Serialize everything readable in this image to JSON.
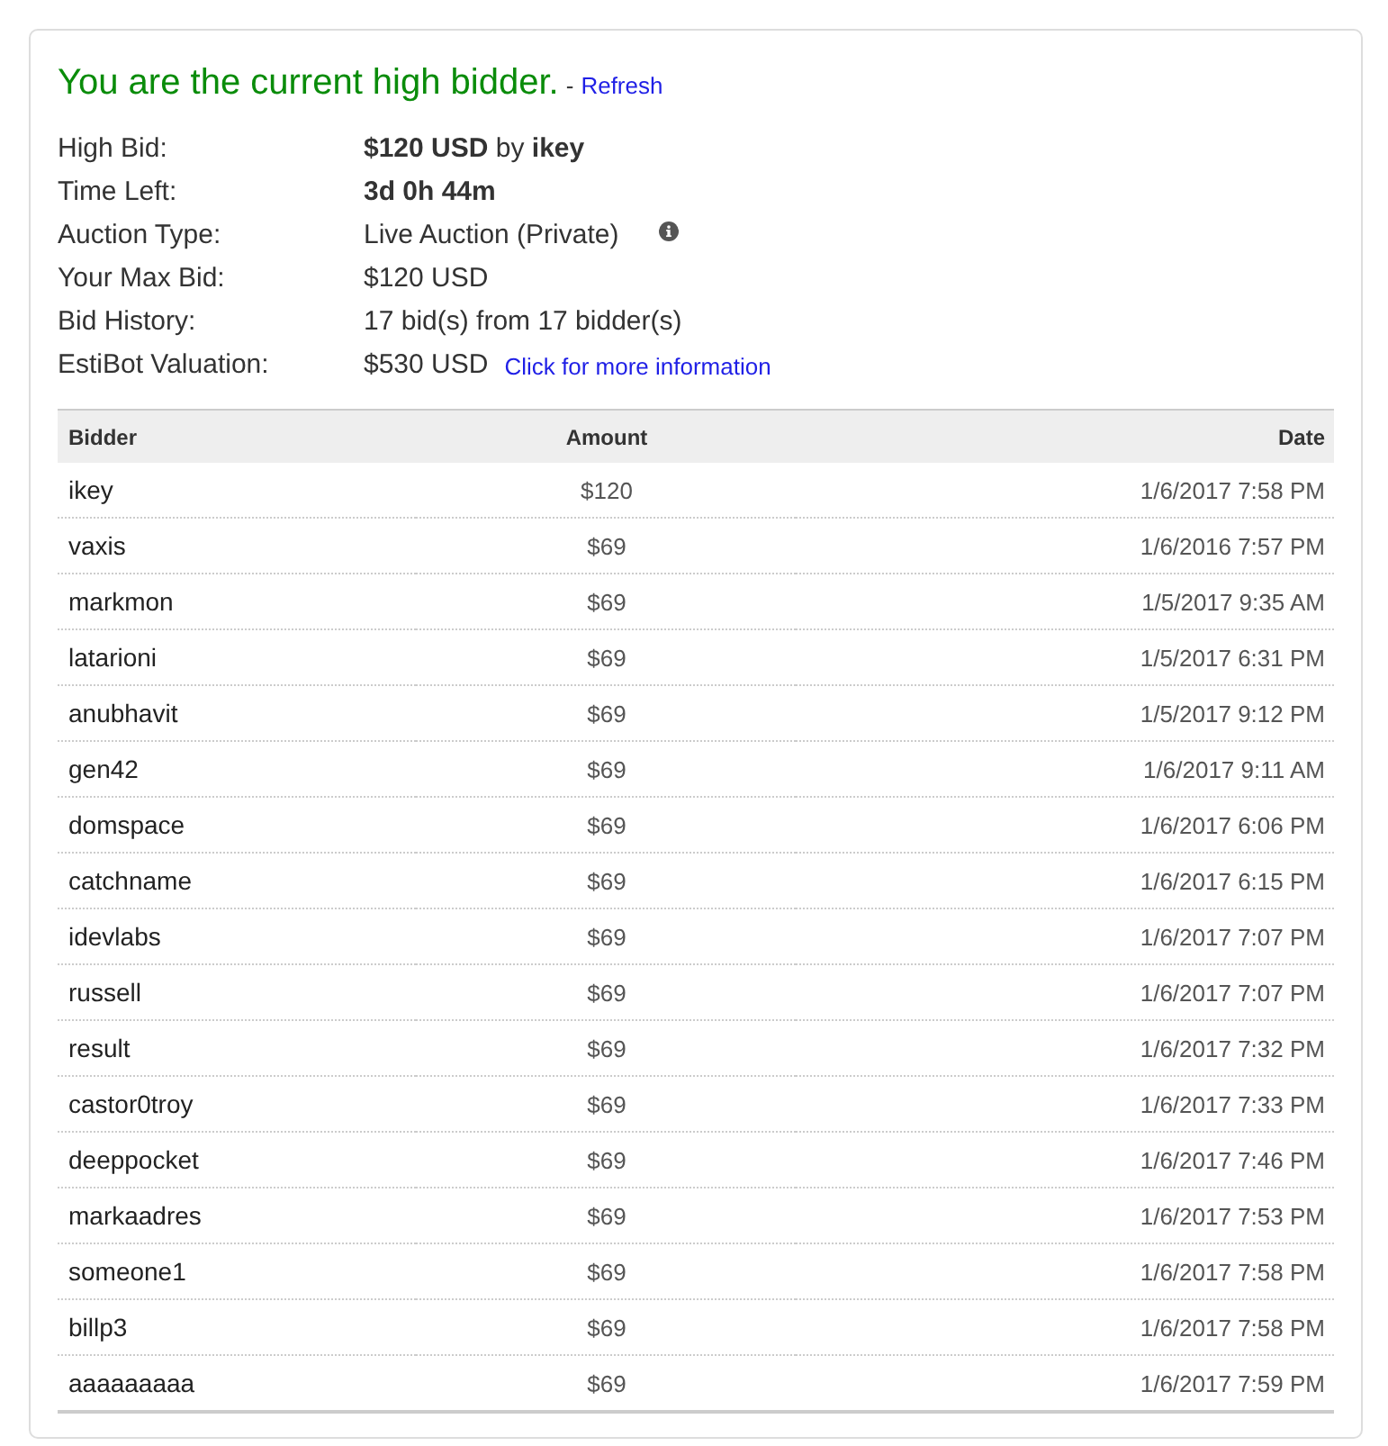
{
  "status": {
    "message": "You are the current high bidder.",
    "separator": "-",
    "refresh_link": "Refresh"
  },
  "details": [
    {
      "label": "High Bid:",
      "value": "**$120 USD** by **ikey**",
      "bold": false,
      "info_icon": false
    },
    {
      "label": "Time Left:",
      "value": "3d 0h 44m",
      "bold": true,
      "info_icon": false
    },
    {
      "label": "Auction Type:",
      "value": "Live Auction (Private)",
      "bold": false,
      "info_icon": true
    },
    {
      "label": "Your Max Bid:",
      "value": "$120 USD",
      "bold": false,
      "info_icon": false
    },
    {
      "label": "Bid History:",
      "value": "17 bid(s) from 17 bidder(s)",
      "bold": false,
      "info_icon": false
    },
    {
      "label": "EstiBot Valuation:",
      "value": "$530 USD",
      "bold": false,
      "info_icon": false,
      "link": "Click for more information"
    }
  ],
  "table": {
    "columns": [
      "Bidder",
      "Amount",
      "Date"
    ],
    "rows": [
      {
        "bidder": "ikey",
        "amount": "$120",
        "date": "1/6/2017 7:58 PM"
      },
      {
        "bidder": "vaxis",
        "amount": "$69",
        "date": "1/6/2016 7:57 PM"
      },
      {
        "bidder": "markmon",
        "amount": "$69",
        "date": "1/5/2017 9:35 AM"
      },
      {
        "bidder": "latarioni",
        "amount": "$69",
        "date": "1/5/2017 6:31 PM"
      },
      {
        "bidder": "anubhavit",
        "amount": "$69",
        "date": "1/5/2017 9:12 PM"
      },
      {
        "bidder": "gen42",
        "amount": "$69",
        "date": "1/6/2017 9:11 AM"
      },
      {
        "bidder": "domspace",
        "amount": "$69",
        "date": "1/6/2017 6:06 PM"
      },
      {
        "bidder": "catchname",
        "amount": "$69",
        "date": "1/6/2017 6:15 PM"
      },
      {
        "bidder": "idevlabs",
        "amount": "$69",
        "date": "1/6/2017 7:07 PM"
      },
      {
        "bidder": "russell",
        "amount": "$69",
        "date": "1/6/2017 7:07 PM"
      },
      {
        "bidder": "result",
        "amount": "$69",
        "date": "1/6/2017 7:32 PM"
      },
      {
        "bidder": "castor0troy",
        "amount": "$69",
        "date": "1/6/2017 7:33 PM"
      },
      {
        "bidder": "deeppocket",
        "amount": "$69",
        "date": "1/6/2017 7:46 PM"
      },
      {
        "bidder": "markaadres",
        "amount": "$69",
        "date": "1/6/2017 7:53 PM"
      },
      {
        "bidder": "someone1",
        "amount": "$69",
        "date": "1/6/2017 7:58 PM"
      },
      {
        "bidder": "billp3",
        "amount": "$69",
        "date": "1/6/2017 7:58 PM"
      },
      {
        "bidder": "aaaaaaaaa",
        "amount": "$69",
        "date": "1/6/2017 7:59 PM"
      }
    ]
  }
}
